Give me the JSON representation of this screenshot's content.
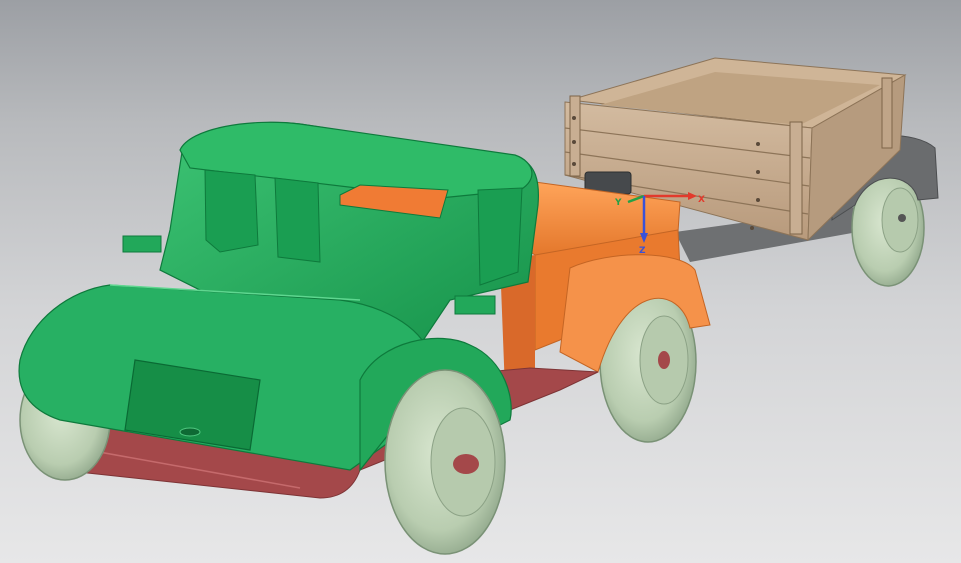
{
  "scene": {
    "background_top": "#9c9fa4",
    "background_bottom": "#e7e7e8",
    "model": "toy-truck-with-trailer",
    "part_colors": {
      "cab_hood": "#22a85a",
      "bed": "#f08a3a",
      "chassis": "#a4484a",
      "wheels": "#c2d4b8",
      "trailer_box": "#c8ae92",
      "trailer_fender": "#6a6c6e"
    }
  },
  "triad": {
    "x_label": "X",
    "y_label": "Y",
    "z_label": "Z",
    "x_color": "#e23a2c",
    "y_color": "#26a046",
    "z_color": "#3a52d8"
  }
}
